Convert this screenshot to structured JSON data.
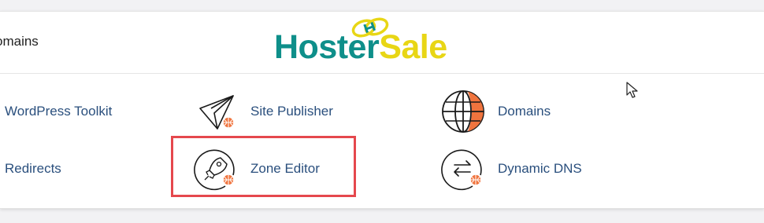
{
  "header": {
    "title": "omains",
    "logo": {
      "part1": "Hoster",
      "part2": "Sale"
    }
  },
  "tools": {
    "wordpress_toolkit": {
      "label": "WordPress Toolkit"
    },
    "site_publisher": {
      "label": "Site Publisher",
      "icon": "paper-plane-icon"
    },
    "domains": {
      "label": "Domains",
      "icon": "globe-icon"
    },
    "redirects": {
      "label": "Redirects"
    },
    "zone_editor": {
      "label": "Zone Editor",
      "icon": "rocket-icon",
      "highlighted": true
    },
    "dynamic_dns": {
      "label": "Dynamic DNS",
      "icon": "swap-arrows-icon"
    }
  },
  "colors": {
    "link": "#2a4f7d",
    "accent_orange": "#f0743e",
    "logo_teal": "#0e8f8a",
    "logo_yellow": "#e8d615",
    "highlight_red": "#e5484d"
  }
}
